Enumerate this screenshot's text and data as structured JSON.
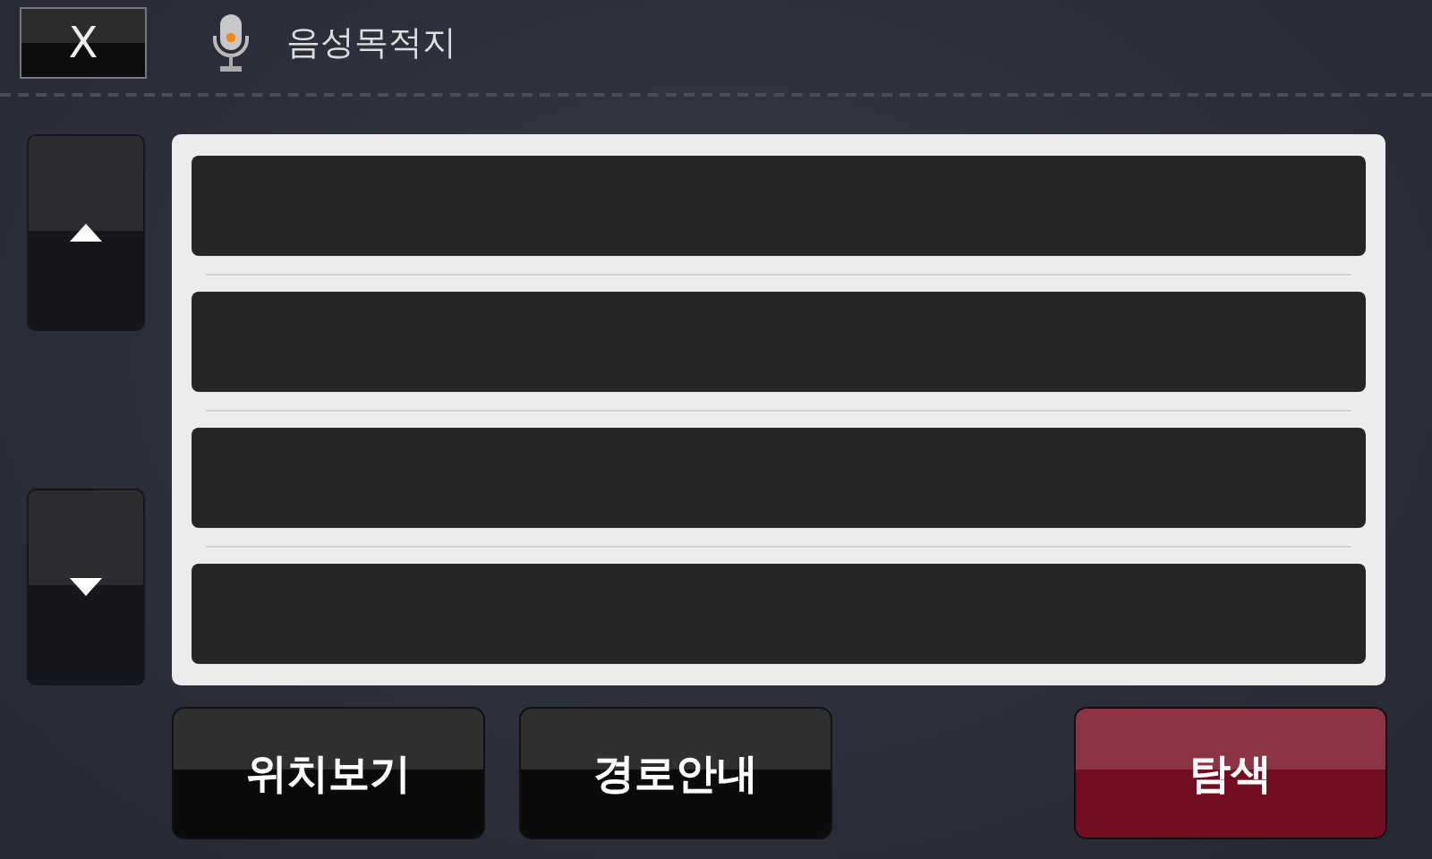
{
  "header": {
    "close_label": "X",
    "title": "음성목적지"
  },
  "scroll_buttons": [
    {
      "kind": "up"
    },
    {
      "kind": "down"
    }
  ],
  "result_rows": [
    {
      "kind": "empty"
    },
    {
      "kind": "empty"
    },
    {
      "kind": "empty"
    },
    {
      "kind": "empty"
    }
  ],
  "actions": [
    {
      "label": "위치보기",
      "kind": "dark"
    },
    {
      "label": "경로안내",
      "kind": "dark"
    },
    {
      "label": "탐색",
      "kind": "accent"
    }
  ]
}
